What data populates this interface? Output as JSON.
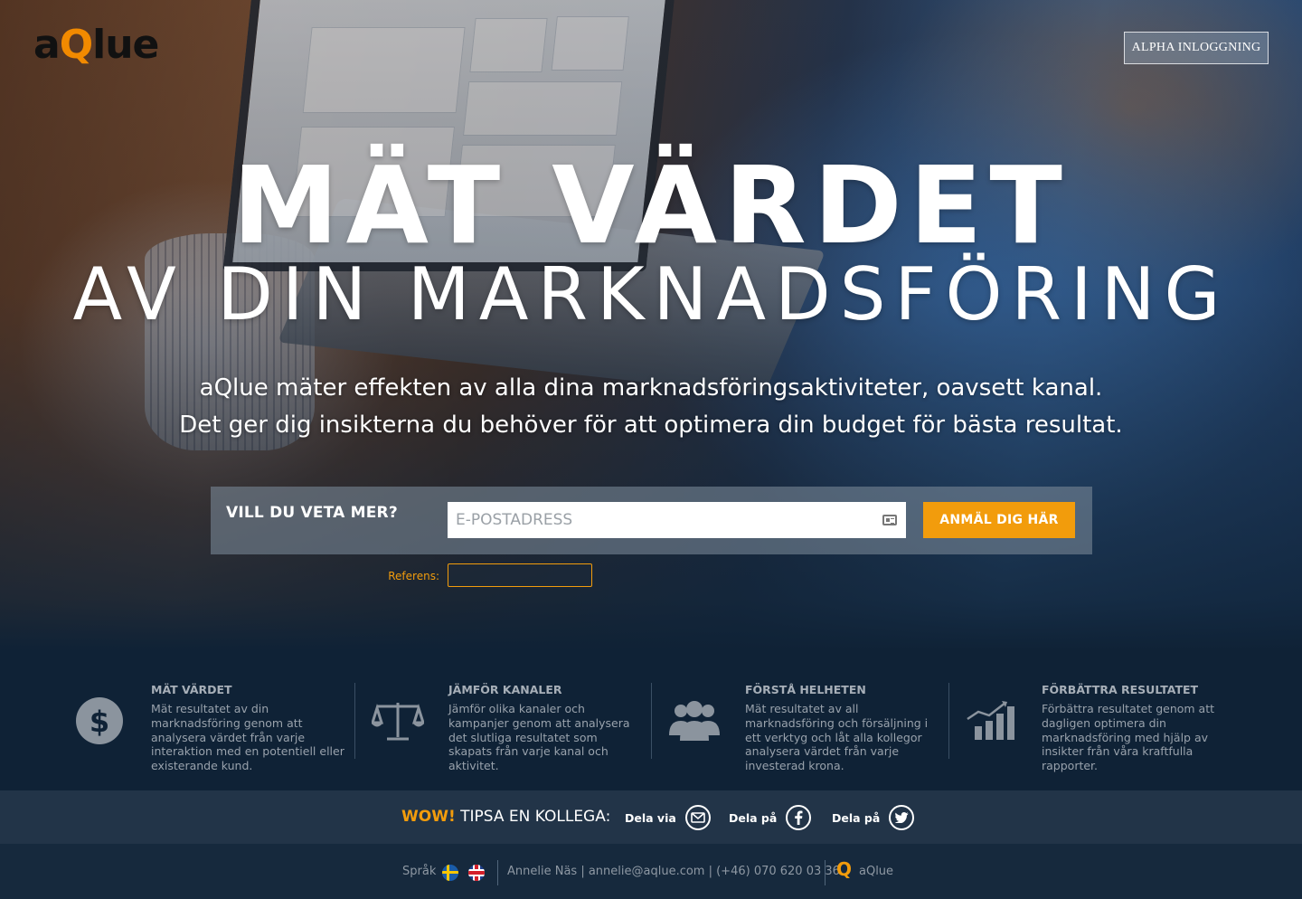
{
  "header": {
    "brand": {
      "prefix": "a",
      "q": "Q",
      "suffix": "lue"
    },
    "login_button": "ALPHA INLOGGNING"
  },
  "hero": {
    "headline_line1": "MÄT VÄRDET",
    "headline_line2": "AV DIN MARKNADSFÖRING",
    "lead_line1": "aQlue mäter effekten av alla dina marknadsföringsaktiviteter, oavsett kanal.",
    "lead_line2": "Det ger dig insikterna du behöver för att optimera din budget för bästa resultat."
  },
  "signup": {
    "label": "VILL DU VETA MER?",
    "email_placeholder": "E-POSTADRESS",
    "email_value": "",
    "submit_label": "ANMÄL DIG HÄR",
    "referens_label": "Referens:",
    "referens_value": ""
  },
  "features": [
    {
      "title": "MÄT VÄRDET",
      "text": "Mät resultatet av din marknadsföring genom att analysera värdet från varje interaktion med en potentiell eller existerande kund.",
      "icon": "dollar-icon"
    },
    {
      "title": "JÄMFÖR KANALER",
      "text": "Jämför olika kanaler och kampanjer genom att analysera det slutliga resultatet som skapats från varje kanal och aktivitet.",
      "icon": "scale-icon"
    },
    {
      "title": "FÖRSTÅ HELHETEN",
      "text": "Mät resultatet av all marknadsföring och försäljning i ett verktyg och låt alla kollegor analysera värdet från varje investerad krona.",
      "icon": "people-icon"
    },
    {
      "title": "FÖRBÄTTRA RESULTATET",
      "text": "Förbättra resultatet genom att dagligen optimera din marknadsföring med hjälp av insikter från våra kraftfulla rapporter.",
      "icon": "chart-growth-icon"
    }
  ],
  "share": {
    "wow": "WOW!",
    "title": "TIPSA EN KOLLEGA:",
    "items": [
      {
        "label": "Dela via",
        "icon": "email-icon"
      },
      {
        "label": "Dela på",
        "icon": "facebook-icon"
      },
      {
        "label": "Dela på",
        "icon": "twitter-icon"
      }
    ]
  },
  "footer": {
    "language_label": "Språk",
    "contact": "Annelie Näs | annelie@aqlue.com | (+46) 070 620 03 36",
    "brand": "aQlue",
    "q": "Q"
  },
  "colors": {
    "accent": "#f29c0c",
    "navy": "#0f2236",
    "share_bar": "#223448",
    "footer": "#16293d"
  }
}
